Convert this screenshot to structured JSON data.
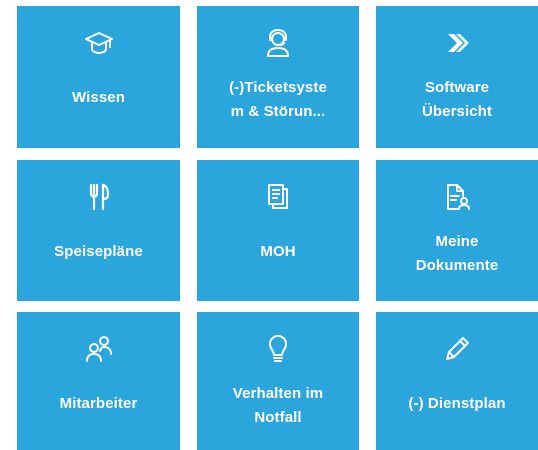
{
  "tiles": [
    {
      "label": "Wissen",
      "icon": "graduation-cap-icon"
    },
    {
      "label": "(-)Ticketsyste\nm & Störun...",
      "icon": "headset-user-icon"
    },
    {
      "label": "Software\nÜbersicht",
      "icon": "play-arrow-icon"
    },
    {
      "label": "Speisepläne",
      "icon": "fork-knife-icon"
    },
    {
      "label": "MOH",
      "icon": "copy-documents-icon"
    },
    {
      "label": "Meine\nDokumente",
      "icon": "document-user-icon"
    },
    {
      "label": "Mitarbeiter",
      "icon": "people-icon"
    },
    {
      "label": "Verhalten im\nNotfall",
      "icon": "lightbulb-icon"
    },
    {
      "label": "(-) Dienstplan",
      "icon": "pencil-icon"
    }
  ],
  "colors": {
    "tile_background": "#2ba6dd",
    "tile_foreground": "#ffffff",
    "page_background": "#ffffff"
  }
}
